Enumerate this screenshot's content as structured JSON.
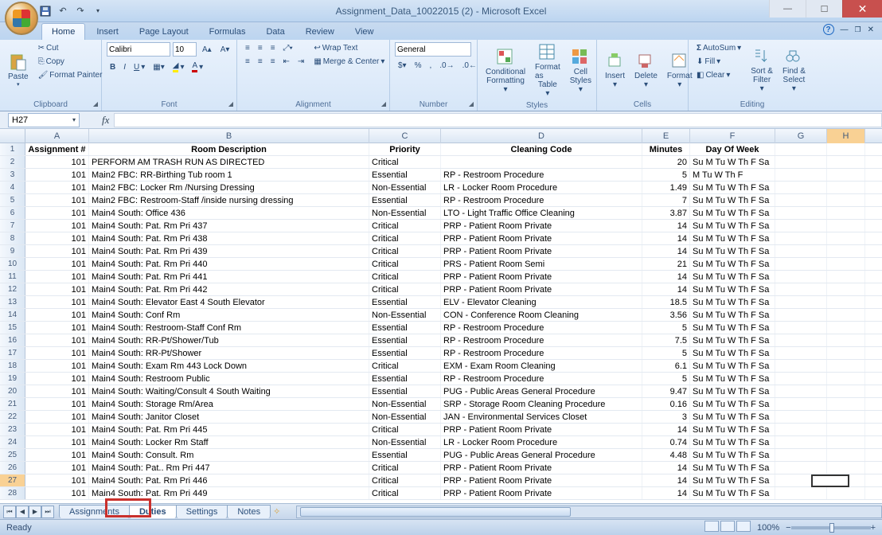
{
  "window": {
    "title": "Assignment_Data_10022015 (2) - Microsoft Excel"
  },
  "tabs": {
    "items": [
      "Home",
      "Insert",
      "Page Layout",
      "Formulas",
      "Data",
      "Review",
      "View"
    ],
    "active": "Home"
  },
  "ribbon": {
    "clipboard": {
      "label": "Clipboard",
      "paste": "Paste",
      "cut": "Cut",
      "copy": "Copy",
      "format_painter": "Format Painter"
    },
    "font": {
      "label": "Font",
      "name": "Calibri",
      "size": "10"
    },
    "alignment": {
      "label": "Alignment",
      "wrap": "Wrap Text",
      "merge": "Merge & Center"
    },
    "number": {
      "label": "Number",
      "format": "General"
    },
    "styles": {
      "label": "Styles",
      "cond": "Conditional",
      "cond2": "Formatting",
      "fas": "Format as",
      "fas2": "Table",
      "cell": "Cell",
      "cell2": "Styles"
    },
    "cells": {
      "label": "Cells",
      "insert": "Insert",
      "delete": "Delete",
      "format": "Format"
    },
    "editing": {
      "label": "Editing",
      "autosum": "AutoSum",
      "fill": "Fill",
      "clear": "Clear",
      "sort": "Sort &",
      "sort2": "Filter",
      "find": "Find &",
      "find2": "Select"
    }
  },
  "namebox": "H27",
  "columns": [
    "A",
    "B",
    "C",
    "D",
    "E",
    "F",
    "G",
    "H"
  ],
  "headers": {
    "A": "Assignment #",
    "B": "Room Description",
    "C": "Priority",
    "D": "Cleaning Code",
    "E": "Minutes",
    "F": "Day Of Week"
  },
  "rows": [
    {
      "n": 101,
      "desc": "PERFORM AM TRASH RUN AS DIRECTED",
      "pri": "Critical",
      "code": "",
      "min": "20",
      "dow": "Su M Tu W Th F Sa"
    },
    {
      "n": 101,
      "desc": "Main2 FBC: RR-Birthing Tub room 1",
      "pri": "Essential",
      "code": "RP - Restroom Procedure",
      "min": "5",
      "dow": "M Tu W Th F"
    },
    {
      "n": 101,
      "desc": "Main2 FBC: Locker Rm /Nursing Dressing",
      "pri": "Non-Essential",
      "code": "LR - Locker Room Procedure",
      "min": "1.49",
      "dow": "Su M Tu W Th F Sa"
    },
    {
      "n": 101,
      "desc": "Main2 FBC: Restroom-Staff /inside nursing dressing",
      "pri": "Essential",
      "code": "RP - Restroom Procedure",
      "min": "7",
      "dow": "Su M Tu W Th F Sa"
    },
    {
      "n": 101,
      "desc": "Main4 South: Office 436",
      "pri": "Non-Essential",
      "code": "LTO - Light Traffic Office Cleaning",
      "min": "3.87",
      "dow": "Su M Tu W Th F Sa"
    },
    {
      "n": 101,
      "desc": "Main4 South: Pat. Rm Pri 437",
      "pri": "Critical",
      "code": "PRP - Patient Room Private",
      "min": "14",
      "dow": "Su M Tu W Th F Sa"
    },
    {
      "n": 101,
      "desc": "Main4 South: Pat. Rm Pri 438",
      "pri": "Critical",
      "code": "PRP - Patient Room Private",
      "min": "14",
      "dow": "Su M Tu W Th F Sa"
    },
    {
      "n": 101,
      "desc": "Main4 South: Pat. Rm Pri 439",
      "pri": "Critical",
      "code": "PRP - Patient Room Private",
      "min": "14",
      "dow": "Su M Tu W Th F Sa"
    },
    {
      "n": 101,
      "desc": "Main4 South: Pat. Rm Pri 440",
      "pri": "Critical",
      "code": "PRS - Patient Room Semi",
      "min": "21",
      "dow": "Su M Tu W Th F Sa"
    },
    {
      "n": 101,
      "desc": "Main4 South: Pat. Rm Pri 441",
      "pri": "Critical",
      "code": "PRP - Patient Room Private",
      "min": "14",
      "dow": "Su M Tu W Th F Sa"
    },
    {
      "n": 101,
      "desc": "Main4 South: Pat. Rm Pri 442",
      "pri": "Critical",
      "code": "PRP - Patient Room Private",
      "min": "14",
      "dow": "Su M Tu W Th F Sa"
    },
    {
      "n": 101,
      "desc": "Main4 South: Elevator East 4 South Elevator",
      "pri": "Essential",
      "code": "ELV - Elevator Cleaning",
      "min": "18.5",
      "dow": "Su M Tu W Th F Sa"
    },
    {
      "n": 101,
      "desc": "Main4 South: Conf Rm",
      "pri": "Non-Essential",
      "code": "CON - Conference Room Cleaning",
      "min": "3.56",
      "dow": "Su M Tu W Th F Sa"
    },
    {
      "n": 101,
      "desc": "Main4 South: Restroom-Staff Conf Rm",
      "pri": "Essential",
      "code": "RP - Restroom Procedure",
      "min": "5",
      "dow": "Su M Tu W Th F Sa"
    },
    {
      "n": 101,
      "desc": "Main4 South: RR-Pt/Shower/Tub",
      "pri": "Essential",
      "code": "RP - Restroom Procedure",
      "min": "7.5",
      "dow": "Su M Tu W Th F Sa"
    },
    {
      "n": 101,
      "desc": "Main4 South: RR-Pt/Shower",
      "pri": "Essential",
      "code": "RP - Restroom Procedure",
      "min": "5",
      "dow": "Su M Tu W Th F Sa"
    },
    {
      "n": 101,
      "desc": "Main4 South: Exam Rm 443 Lock Down",
      "pri": "Critical",
      "code": "EXM - Exam Room Cleaning",
      "min": "6.1",
      "dow": "Su M Tu W Th F Sa"
    },
    {
      "n": 101,
      "desc": "Main4 South: Restroom Public",
      "pri": "Essential",
      "code": "RP - Restroom Procedure",
      "min": "5",
      "dow": "Su M Tu W Th F Sa"
    },
    {
      "n": 101,
      "desc": "Main4 South: Waiting/Consult 4 South Waiting",
      "pri": "Essential",
      "code": "PUG - Public Areas General Procedure",
      "min": "9.47",
      "dow": "Su M Tu W Th F Sa"
    },
    {
      "n": 101,
      "desc": "Main4 South: Storage Rm/Area",
      "pri": "Non-Essential",
      "code": "SRP - Storage Room Cleaning Procedure",
      "min": "0.16",
      "dow": "Su M Tu W Th F Sa"
    },
    {
      "n": 101,
      "desc": "Main4 South: Janitor Closet",
      "pri": "Non-Essential",
      "code": "JAN - Environmental Services Closet",
      "min": "3",
      "dow": "Su M Tu W Th F Sa"
    },
    {
      "n": 101,
      "desc": "Main4 South: Pat. Rm Pri 445",
      "pri": "Critical",
      "code": "PRP - Patient Room Private",
      "min": "14",
      "dow": "Su M Tu W Th F Sa"
    },
    {
      "n": 101,
      "desc": "Main4 South: Locker Rm Staff",
      "pri": "Non-Essential",
      "code": "LR - Locker Room Procedure",
      "min": "0.74",
      "dow": "Su M Tu W Th F Sa"
    },
    {
      "n": 101,
      "desc": "Main4 South: Consult. Rm",
      "pri": "Essential",
      "code": "PUG - Public Areas General Procedure",
      "min": "4.48",
      "dow": "Su M Tu W Th F Sa"
    },
    {
      "n": 101,
      "desc": "Main4 South: Pat.. Rm Pri 447",
      "pri": "Critical",
      "code": "PRP - Patient Room Private",
      "min": "14",
      "dow": "Su M Tu W Th F Sa"
    },
    {
      "n": 101,
      "desc": "Main4 South: Pat. Rm Pri 446",
      "pri": "Critical",
      "code": "PRP - Patient Room Private",
      "min": "14",
      "dow": "Su M Tu W Th F Sa"
    },
    {
      "n": 101,
      "desc": "Main4 South: Pat. Rm Pri 449",
      "pri": "Critical",
      "code": "PRP - Patient Room Private",
      "min": "14",
      "dow": "Su M Tu W Th F Sa"
    }
  ],
  "sheets": {
    "items": [
      "Assignments",
      "Duties",
      "Settings",
      "Notes"
    ],
    "active": "Duties"
  },
  "status": {
    "ready": "Ready",
    "zoom": "100%"
  },
  "active_row": 27
}
